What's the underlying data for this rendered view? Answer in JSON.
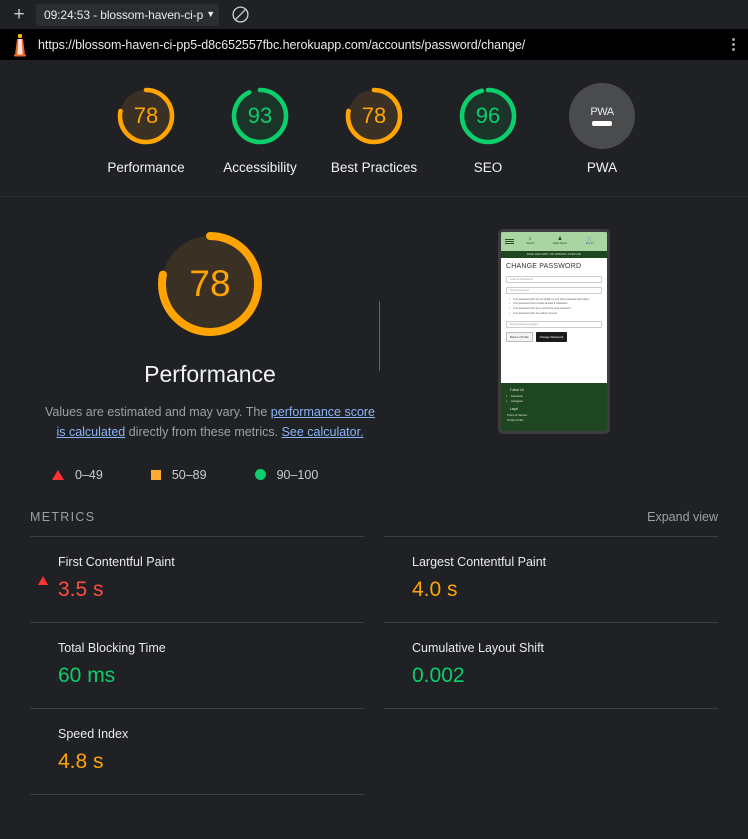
{
  "browser": {
    "new_tab_label": "+",
    "tab_title": "09:24:53 - blossom-haven-ci-p",
    "tab_caret": "▼",
    "block_icon": "no-entry-icon",
    "url": "https://blossom-haven-ci-pp5-d8c652557fbc.herokuapp.com/accounts/password/change/",
    "menu_icon": "kebab-menu-icon"
  },
  "scores": [
    {
      "label": "Performance",
      "value": "78",
      "percent": 78,
      "color": "#ffa400",
      "track": "#3b3024"
    },
    {
      "label": "Accessibility",
      "value": "93",
      "percent": 93,
      "color": "#0cce6b",
      "track": "#1b3328"
    },
    {
      "label": "Best Practices",
      "value": "78",
      "percent": 78,
      "color": "#ffa400",
      "track": "#3b3024"
    },
    {
      "label": "SEO",
      "value": "96",
      "percent": 96,
      "color": "#0cce6b",
      "track": "#1b3328"
    },
    {
      "label": "PWA",
      "value": "",
      "percent": 0,
      "color": "#9aa0a6",
      "track": "#4a4b4d"
    }
  ],
  "pwa": {
    "badge_text": "PWA",
    "dash": "—"
  },
  "category": {
    "gauge_value": "78",
    "gauge_percent": 78,
    "gauge_color": "#ffa400",
    "gauge_track": "#3b3024",
    "title": "Performance",
    "desc_part1": "Values are estimated and may vary. The ",
    "desc_link1": "performance score is calculated",
    "desc_part2": " directly from these metrics. ",
    "desc_link2": "See calculator."
  },
  "legend": [
    {
      "icon": "triangle-red-icon",
      "range": "0–49"
    },
    {
      "icon": "square-orange-icon",
      "range": "50–89"
    },
    {
      "icon": "circle-green-icon",
      "range": "90–100"
    }
  ],
  "metrics_section": {
    "title": "METRICS",
    "expand_label": "Expand view"
  },
  "metrics": [
    {
      "name": "First Contentful Paint",
      "value": "3.5 s",
      "status": "fail",
      "color": "#ff4e42",
      "icon": "triangle-red-icon"
    },
    {
      "name": "Largest Contentful Paint",
      "value": "4.0 s",
      "status": "average",
      "color": "#ffa400",
      "icon": "square-orange-icon"
    },
    {
      "name": "Total Blocking Time",
      "value": "60 ms",
      "status": "pass",
      "color": "#0cce6b",
      "icon": "circle-green-icon"
    },
    {
      "name": "Cumulative Layout Shift",
      "value": "0.002",
      "status": "pass",
      "color": "#0cce6b",
      "icon": "circle-green-icon"
    },
    {
      "name": "Speed Index",
      "value": "4.8 s",
      "status": "average",
      "color": "#ffa400",
      "icon": "square-orange-icon"
    }
  ],
  "screenshot_thumb": {
    "nav": {
      "menu_icon": "hamburger-icon",
      "search_icon": "magnifier-icon",
      "search_label": "Search",
      "account_icon": "person-icon",
      "account_label": "Hello Admin",
      "cart_icon": "cart-icon",
      "cart_label": "£54.49"
    },
    "banner": "FREE DELIVERY ON ORDERS OVER £50",
    "heading": "CHANGE PASSWORD",
    "field_current": "Current Password",
    "field_new": "New Password",
    "hints": [
      "Your password can't be too similar to your other personal information.",
      "Your password must contain at least 8 characters.",
      "Your password can't be a commonly used password.",
      "Your password can't be entirely numeric."
    ],
    "field_confirm": "New Password (again)",
    "btn_back": "Back to Profile",
    "btn_submit": "Change Password",
    "footer": {
      "follow_title": "Follow Us",
      "follow_items": [
        "Facebook",
        "Instagram"
      ],
      "legal_title": "Legal",
      "legal_items": [
        "Terms of Service",
        "Privacy Policy"
      ]
    }
  }
}
